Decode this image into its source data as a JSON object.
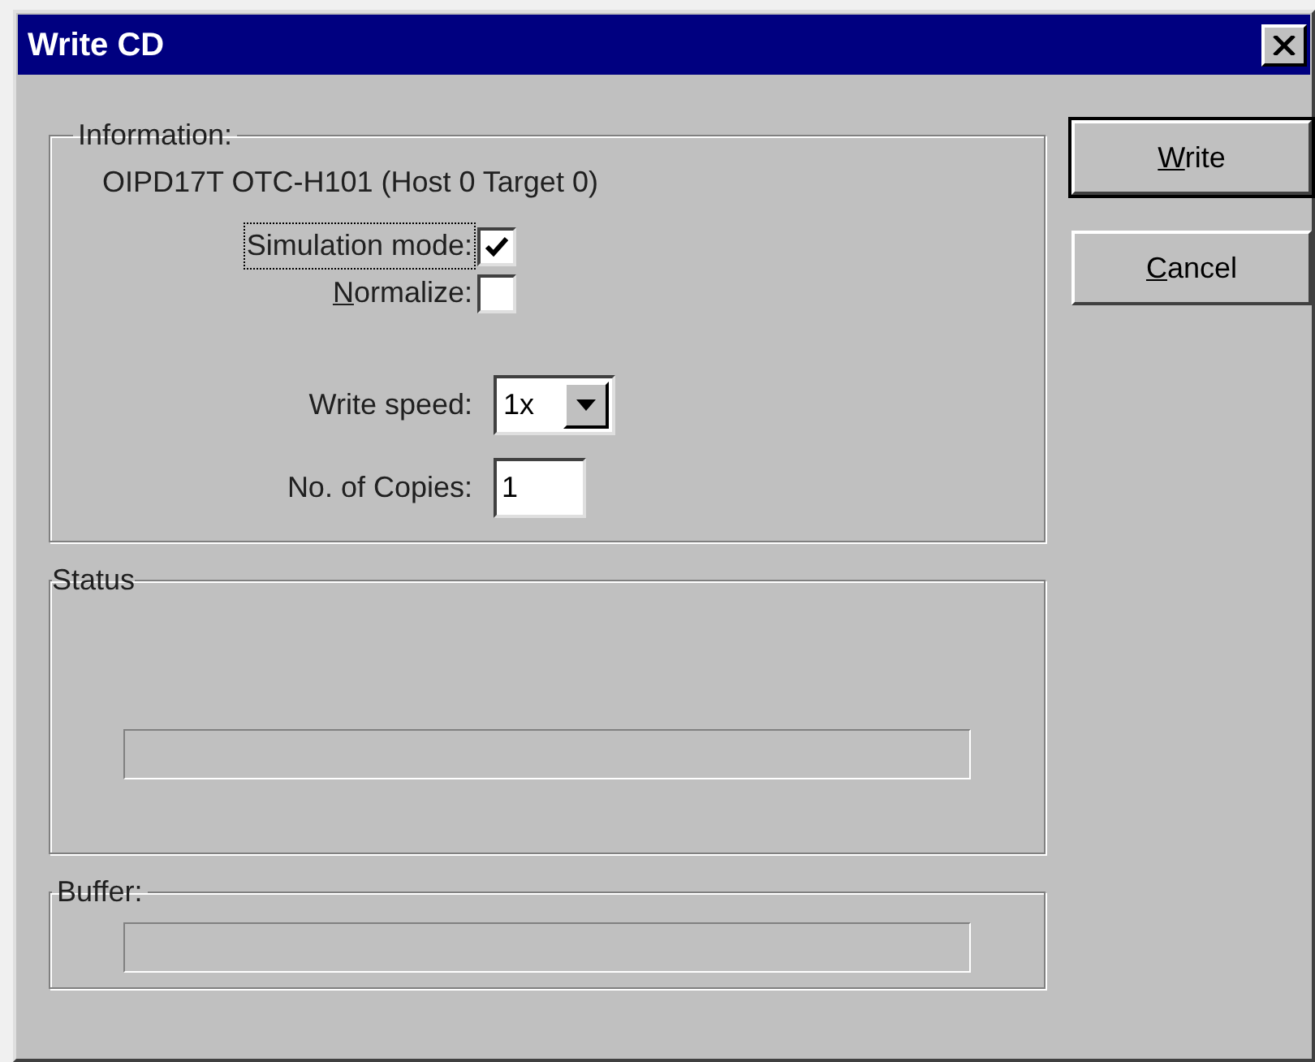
{
  "window": {
    "title": "Write CD"
  },
  "information": {
    "legend": "Information:",
    "device": "OIPD17T OTC-H101 (Host 0 Target 0)",
    "options": [
      {
        "kind": "checkbox",
        "label": "Simulation mode:",
        "checked": true,
        "focused": true,
        "mnemonic_underlined": false
      },
      {
        "kind": "checkbox",
        "label": "Normalize:",
        "checked": false,
        "focused": false,
        "mnemonic_underlined": true
      },
      {
        "kind": "dropdown",
        "label": "Write speed:",
        "value": "1x"
      },
      {
        "kind": "input",
        "label": "No. of Copies:",
        "value": "1"
      }
    ]
  },
  "status": {
    "legend": "Status",
    "progress": {
      "level": 0
    }
  },
  "buffer": {
    "legend": "Buffer:",
    "progress": {
      "level": 0
    }
  },
  "buttons": [
    {
      "label": "Write",
      "default": true,
      "mnemonic_underlined": true
    },
    {
      "label": "Cancel",
      "default": false,
      "mnemonic_underlined": true
    }
  ]
}
